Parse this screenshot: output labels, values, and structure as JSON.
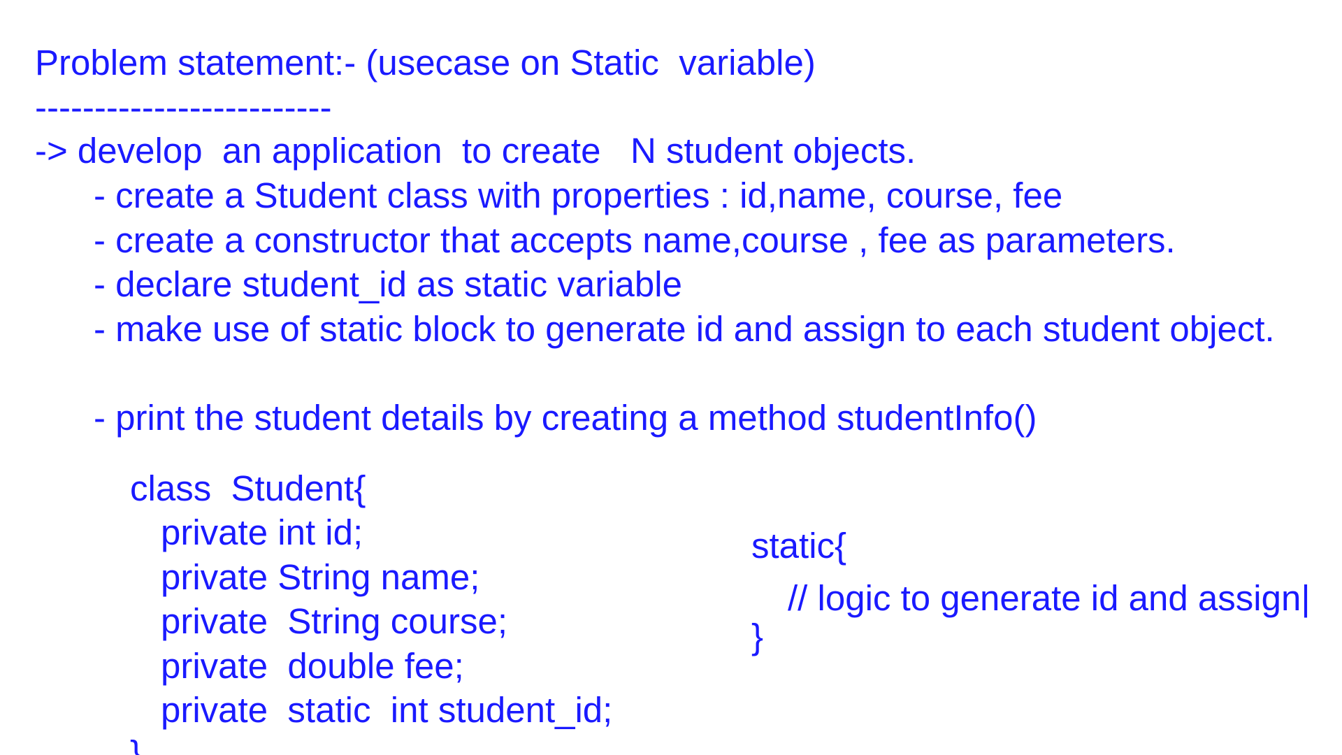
{
  "document": {
    "title": "Problem statement:- (usecase on Static  variable)",
    "divider": "-------------------------",
    "intro": "-> develop  an application  to create   N student objects.",
    "bullets": [
      "- create a Student class with properties : id,name, course, fee",
      "- create a constructor that accepts name,course , fee as parameters.",
      "- declare student_id as static variable",
      "- make use of static block to generate id and assign to each student object.",
      "- print the student details by creating a method studentInfo()"
    ],
    "class_code": {
      "header": "class  Student{",
      "fields": [
        "private int id;",
        "private String name;",
        "private  String course;",
        "private  double fee;",
        "private  static  int student_id;"
      ],
      "close": "}"
    },
    "static_block": {
      "open": "static{",
      "comment": "// logic to generate id and assign|",
      "close": "}"
    }
  },
  "colors": {
    "text": "#1a1aff",
    "background": "#ffffff"
  }
}
